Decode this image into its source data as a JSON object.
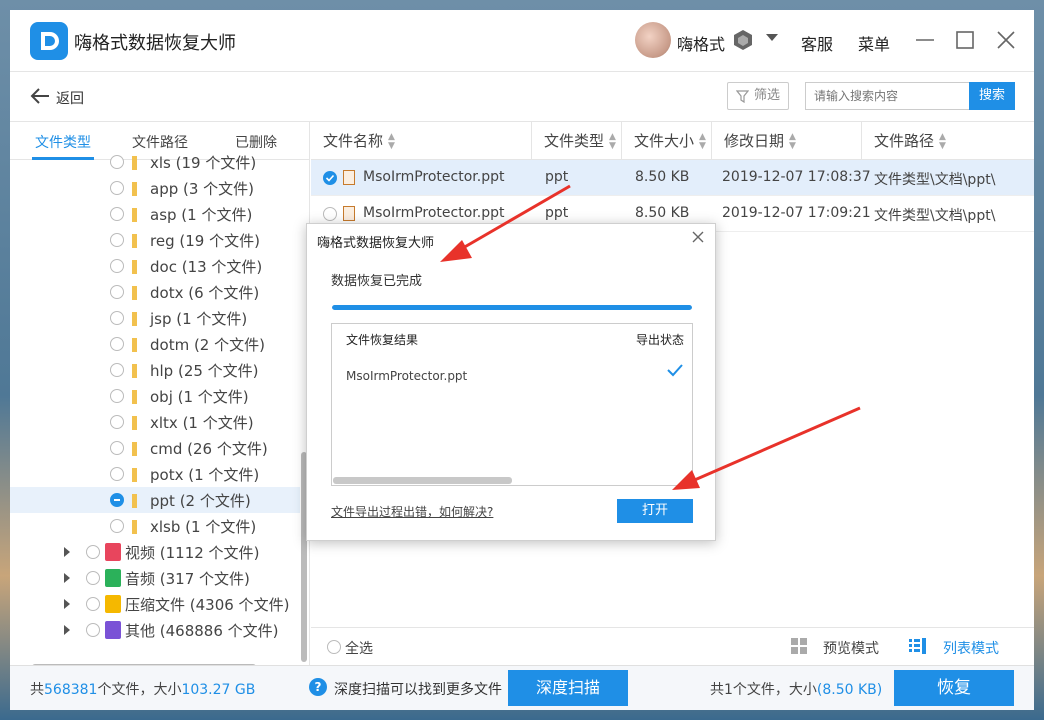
{
  "app": {
    "title": "嗨格式数据恢复大师"
  },
  "user": {
    "name": "嗨格式"
  },
  "titlebar": {
    "service": "客服",
    "menu": "菜单"
  },
  "toolbar": {
    "back": "返回",
    "filter": "筛选",
    "search_placeholder": "请输入搜索内容",
    "search": "搜索"
  },
  "tabs": [
    "文件类型",
    "文件路径",
    "已删除"
  ],
  "tree": [
    {
      "label": "xls (19 个文件)"
    },
    {
      "label": "app (3 个文件)"
    },
    {
      "label": "asp (1 个文件)"
    },
    {
      "label": "reg (19 个文件)"
    },
    {
      "label": "doc (13 个文件)"
    },
    {
      "label": "dotx (6 个文件)"
    },
    {
      "label": "jsp (1 个文件)"
    },
    {
      "label": "dotm (2 个文件)"
    },
    {
      "label": "hlp (25 个文件)"
    },
    {
      "label": "obj (1 个文件)"
    },
    {
      "label": "xltx (1 个文件)"
    },
    {
      "label": "cmd (26 个文件)"
    },
    {
      "label": "potx (1 个文件)"
    },
    {
      "label": "ppt (2 个文件)"
    },
    {
      "label": "xlsb (1 个文件)"
    }
  ],
  "categories": [
    {
      "label": "视频 (1112 个文件)",
      "color": "#e8455d"
    },
    {
      "label": "音频 (317 个文件)",
      "color": "#2bb15a"
    },
    {
      "label": "压缩文件 (4306 个文件)",
      "color": "#f5b800"
    },
    {
      "label": "其他 (468886 个文件)",
      "color": "#7a52d6"
    }
  ],
  "table": {
    "headers": [
      "文件名称",
      "文件类型",
      "文件大小",
      "修改日期",
      "文件路径"
    ],
    "rows": [
      {
        "name": "MsoIrmProtector.ppt",
        "type": "ppt",
        "size": "8.50 KB",
        "date": "2019-12-07 17:08:37",
        "path": "文件类型\\文档\\ppt\\"
      },
      {
        "name": "MsoIrmProtector.ppt",
        "type": "ppt",
        "size": "8.50 KB",
        "date": "2019-12-07 17:09:21",
        "path": "文件类型\\文档\\ppt\\"
      }
    ],
    "select_all": "全选",
    "preview_mode": "预览模式",
    "list_mode": "列表模式"
  },
  "status": {
    "total_prefix": "共",
    "total_count": "568381",
    "total_mid": "个文件，大小",
    "total_size": "103.27 GB",
    "hint": "深度扫描可以找到更多文件",
    "deep_scan": "深度扫描",
    "selected_prefix": "共1个文件，大小",
    "selected_size": "(8.50 KB)",
    "recover": "恢复"
  },
  "dialog": {
    "title": "嗨格式数据恢复大师",
    "status": "数据恢复已完成",
    "progress": 1.0,
    "col_result": "文件恢复结果",
    "col_export": "导出状态",
    "file": "MsoIrmProtector.ppt",
    "help_link": "文件导出过程出错，如何解决?",
    "open": "打开"
  },
  "colors": {
    "accent": "#1f8fe6",
    "annotation": "#e8322a"
  }
}
